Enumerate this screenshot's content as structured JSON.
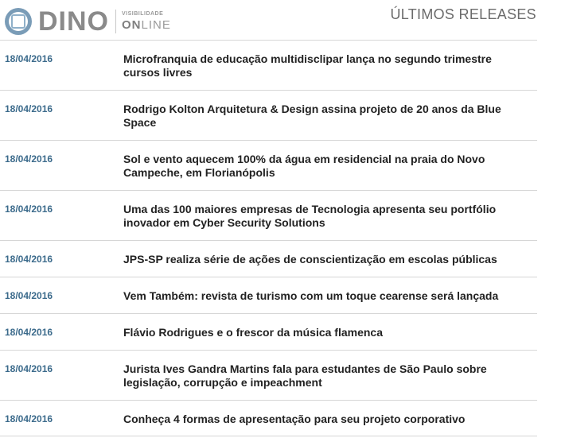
{
  "header": {
    "logo_text": "DINO",
    "logo_tag_top": "VISIBILIDADE",
    "logo_tag_on": "ON",
    "logo_tag_line": "LINE",
    "section_title": "ÚLTIMOS RELEASES"
  },
  "releases": [
    {
      "date": "18/04/2016",
      "title": "Microfranquia de educação multidisclipar lança no segundo trimestre cursos livres"
    },
    {
      "date": "18/04/2016",
      "title": "Rodrigo Kolton Arquitetura & Design assina projeto de 20 anos da Blue Space"
    },
    {
      "date": "18/04/2016",
      "title": "Sol e vento aquecem 100% da água em residencial na praia do Novo Campeche, em Florianópolis"
    },
    {
      "date": "18/04/2016",
      "title": "Uma das 100 maiores empresas de Tecnologia apresenta seu portfólio inovador em Cyber Security Solutions"
    },
    {
      "date": "18/04/2016",
      "title": "JPS-SP realiza série de ações de conscientização em escolas públicas"
    },
    {
      "date": "18/04/2016",
      "title": "Vem Também: revista de turismo com um toque cearense será lançada"
    },
    {
      "date": "18/04/2016",
      "title": "Flávio Rodrigues e o frescor da música flamenca"
    },
    {
      "date": "18/04/2016",
      "title": "Jurista Ives Gandra Martins fala para estudantes de São Paulo sobre legislação, corrupção e impeachment"
    },
    {
      "date": "18/04/2016",
      "title": "Conheça 4 formas de apresentação para seu projeto corporativo"
    }
  ]
}
